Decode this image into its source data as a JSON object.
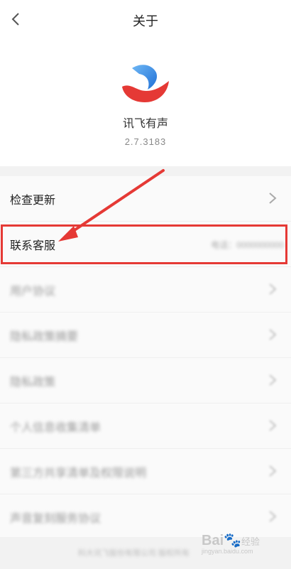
{
  "topbar": {
    "title": "关于"
  },
  "app": {
    "name": "讯飞有声",
    "version": "2.7.3183"
  },
  "rows": [
    {
      "label": "检查更新"
    },
    {
      "label": "联系客服"
    },
    {
      "label": "用户协议"
    },
    {
      "label": "隐私政策摘要"
    },
    {
      "label": "隐私政策"
    },
    {
      "label": "个人信息收集清单"
    },
    {
      "label": "第三方共享清单及权限说明"
    },
    {
      "label": "声音复刻服务协议"
    }
  ],
  "footer": {
    "text": "科大讯飞股份有限公司 版权所有"
  },
  "watermark": {
    "brand": "Bai",
    "suffix": "经验",
    "domain": "jingyan.baidu.com"
  },
  "colors": {
    "highlight": "#e53935",
    "background": "#f2f2f2"
  }
}
